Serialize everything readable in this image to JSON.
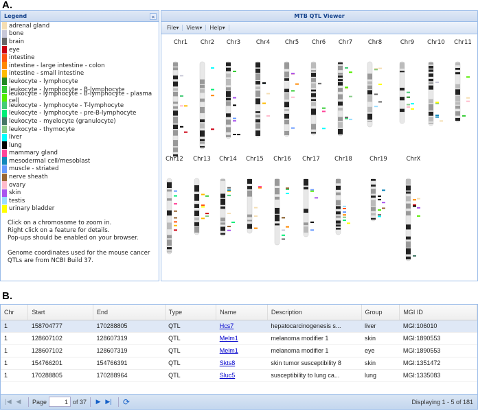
{
  "labels": {
    "a": "A.",
    "b": "B."
  },
  "legend": {
    "title": "Legend",
    "collapse_icon": "double-chevron-left",
    "items": [
      {
        "label": "adrenal gland",
        "color": "#f5deb3"
      },
      {
        "label": "bone",
        "color": "#c8c8d8"
      },
      {
        "label": "brain",
        "color": "#666666"
      },
      {
        "label": "eye",
        "color": "#cc0011"
      },
      {
        "label": "intestine",
        "color": "#ff5511"
      },
      {
        "label": "intestine - large intestine - colon",
        "color": "#ff8800"
      },
      {
        "label": "intestine - small intestine",
        "color": "#ffbb00"
      },
      {
        "label": "leukocyte - lymphocyte",
        "color": "#228822"
      },
      {
        "label": "leukocyte - lymphocyte - B-lymphocyte",
        "color": "#33cc33"
      },
      {
        "label": "leukocyte - lymphocyte - B-lymphocyte - plasma cell",
        "color": "#55ee00"
      },
      {
        "label": "leukocyte - lymphocyte - T-lymphocyte",
        "color": "#44cc77"
      },
      {
        "label": "leukocyte - lymphocyte - pre-B-lymphocyte",
        "color": "#00ee77"
      },
      {
        "label": "leukocyte - myelocyte (granulocyte)",
        "color": "#447766"
      },
      {
        "label": "leukocyte - thymocyte",
        "color": "#88cc88"
      },
      {
        "label": "liver",
        "color": "#00ffff"
      },
      {
        "label": "lung",
        "color": "#000000"
      },
      {
        "label": "mammary gland",
        "color": "#ff4499"
      },
      {
        "label": "mesodermal cell/mesoblast",
        "color": "#1188bb"
      },
      {
        "label": "muscle - striated",
        "color": "#6699ff"
      },
      {
        "label": "nerve sheath",
        "color": "#996633"
      },
      {
        "label": "ovary",
        "color": "#ffbbcc"
      },
      {
        "label": "skin",
        "color": "#aa55ee"
      },
      {
        "label": "testis",
        "color": "#99ddff"
      },
      {
        "label": "urinary bladder",
        "color": "#ffff00"
      }
    ],
    "notes": [
      "Click on a chromosome to zoom in.",
      "Right click on a feature for details.",
      "Pop-ups should be enabled on your browser.",
      "",
      "Genome coordinates used for the mouse cancer",
      "QTLs are from NCBI Build 37."
    ]
  },
  "viewer": {
    "title": "MTB QTL Viewer",
    "menus": [
      "File",
      "View",
      "Help"
    ],
    "chromosomes": [
      "Chr1",
      "Chr2",
      "Chr3",
      "Chr4",
      "Chr5",
      "Chr6",
      "Chr7",
      "Chr8",
      "Chr9",
      "Chr10",
      "Chr11",
      "Chr12",
      "Chr13",
      "Chr14",
      "Chr15",
      "Chr16",
      "Chr17",
      "Chr18",
      "Chr19",
      "ChrX"
    ]
  },
  "grid": {
    "columns": [
      "Chr",
      "Start",
      "End",
      "Type",
      "Name",
      "Description",
      "Group",
      "MGI ID"
    ],
    "rows": [
      [
        "1",
        "158704777",
        "170288805",
        "QTL",
        "Hcs7",
        "hepatocarcinogenesis s...",
        "liver",
        "MGI:106010"
      ],
      [
        "1",
        "128607102",
        "128607319",
        "QTL",
        "Melm1",
        "melanoma modifier 1",
        "skin",
        "MGI:1890553"
      ],
      [
        "1",
        "128607102",
        "128607319",
        "QTL",
        "Melm1",
        "melanoma modifier 1",
        "eye",
        "MGI:1890553"
      ],
      [
        "1",
        "154766201",
        "154766391",
        "QTL",
        "Skts8",
        "skin tumor susceptibility 8",
        "skin",
        "MGI:1351472"
      ],
      [
        "1",
        "170288805",
        "170288964",
        "QTL",
        "Sluc5",
        "susceptibility to lung ca...",
        "lung",
        "MGI:1335083"
      ]
    ],
    "selected_row": 0,
    "pager": {
      "page_label": "Page",
      "page": "1",
      "of": "of 37",
      "display": "Displaying 1 - 5 of 181"
    }
  }
}
